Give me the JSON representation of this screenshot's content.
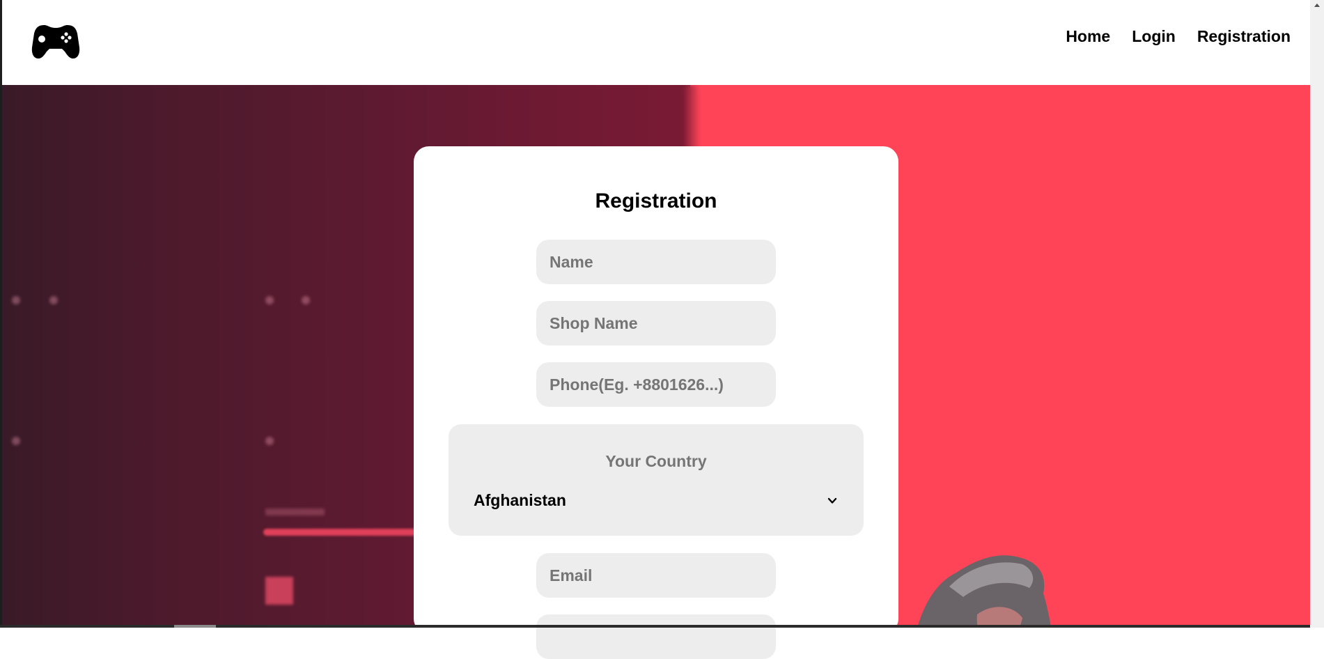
{
  "header": {
    "logo_icon": "gamepad-icon",
    "nav": {
      "home": "Home",
      "login": "Login",
      "registration": "Registration"
    }
  },
  "form": {
    "title": "Registration",
    "name_placeholder": "Name",
    "shop_name_placeholder": "Shop Name",
    "phone_placeholder": "Phone(Eg. +8801626...)",
    "country_label": "Your Country",
    "country_selected": "Afghanistan",
    "email_placeholder": "Email"
  },
  "colors": {
    "accent": "#ff4458",
    "input_bg": "#ededed",
    "placeholder": "#757575"
  }
}
